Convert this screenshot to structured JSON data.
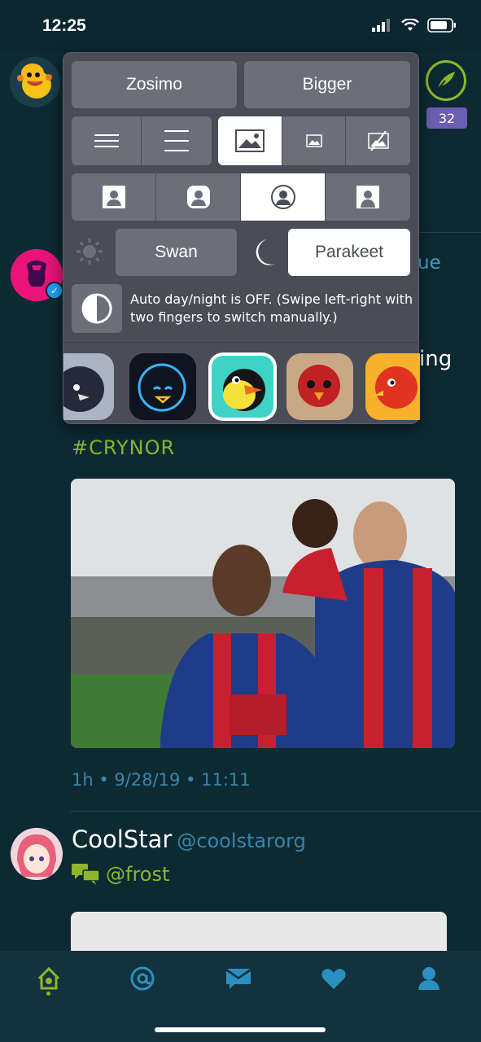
{
  "status_bar": {
    "time": "12:25"
  },
  "feed": {
    "unread_count": "32",
    "peek_text_1": "ue",
    "peek_text_2": "ing",
    "hashtag": "#CRYNOR",
    "tweet_meta": "1h • 9/28/19 • 11:11",
    "next_tweet": {
      "name": "CoolStar",
      "handle": "@coolstarorg",
      "reply_to": "@frost"
    }
  },
  "popover": {
    "font_options": [
      "Zosimo",
      "Bigger"
    ],
    "theme_day": "Swan",
    "theme_night": "Parakeet",
    "auto_note": "Auto day/night is OFF. (Swipe left-right with two fingers to switch manually.)",
    "layout_selected_index": 2,
    "avatar_selected_index": 2,
    "app_icon_selected_index": 2
  },
  "colors": {
    "background": "#0d2a33",
    "accent_green": "#8fb52a",
    "accent_blue": "#3b84a8",
    "popover_bg": "#4a4d57",
    "button_bg": "#6c6f79",
    "badge_purple": "#6b5fb3"
  },
  "tabs": [
    {
      "name": "home-icon"
    },
    {
      "name": "mentions-icon"
    },
    {
      "name": "messages-icon"
    },
    {
      "name": "likes-icon"
    },
    {
      "name": "profile-icon"
    }
  ]
}
